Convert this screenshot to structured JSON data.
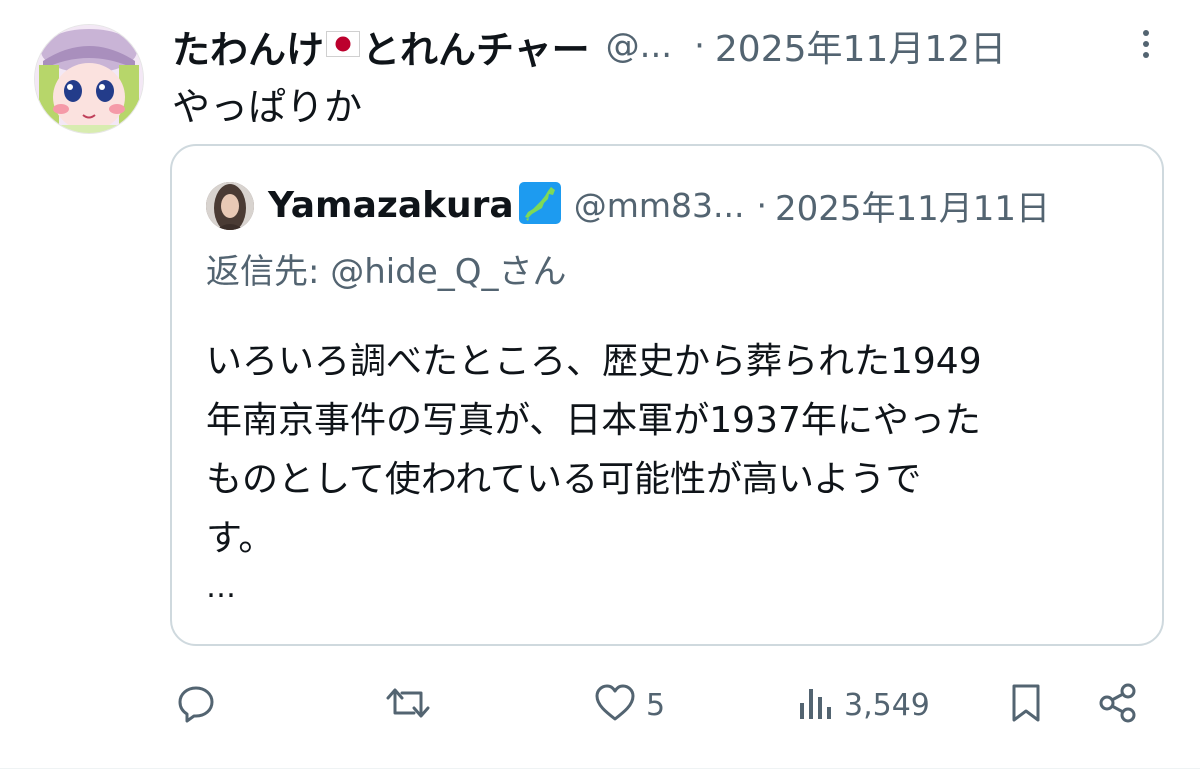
{
  "tweet": {
    "display_name_part1": "たわんけ",
    "display_name_part2": "とれんチャー",
    "handle": "@...",
    "separator": "·",
    "date": "2025年11月12日",
    "text": "やっぱりか"
  },
  "quoted": {
    "display_name": "Yamazakura",
    "handle": "@mm83...",
    "separator": "·",
    "date": "2025年11月11日",
    "reply_to": "返信先: @hide_Q_さん",
    "body_lines": [
      "いろいろ調べたところ、歴史から葬られた1949",
      "年南京事件の写真が、日本軍が1937年にやった",
      "ものとして使われている可能性が高いようで",
      "す。"
    ],
    "ellipsis": "…"
  },
  "actions": {
    "likes": "5",
    "views": "3,549"
  },
  "colors": {
    "text": "#0f1419",
    "secondary": "#536471",
    "border": "#cfd9de",
    "flag_red": "#bc002d",
    "japan_map_bg": "#1d9bf0",
    "japan_map_land": "#7ed957"
  },
  "icons": {
    "flag": "japan-flag-icon",
    "map": "japan-map-icon",
    "more": "more-vertical-icon",
    "reply": "reply-icon",
    "retweet": "retweet-icon",
    "like": "heart-icon",
    "views": "views-icon",
    "bookmark": "bookmark-icon",
    "share": "share-icon"
  }
}
